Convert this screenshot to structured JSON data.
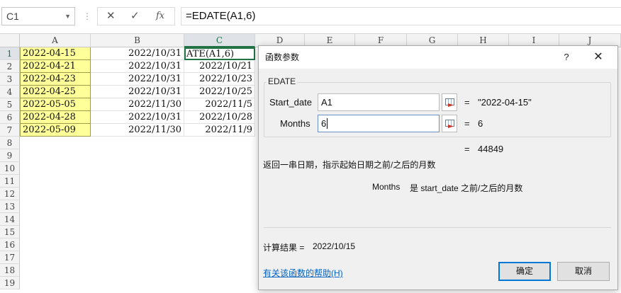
{
  "formula_bar": {
    "name_box": "C1",
    "dots": "⋮",
    "cancel_icon": "✕",
    "enter_icon": "✓",
    "fx_label": "fx",
    "formula": "=EDATE(A1,6)"
  },
  "sheet": {
    "columns": [
      "A",
      "B",
      "C",
      "D",
      "E",
      "F",
      "G",
      "H",
      "I",
      "J"
    ],
    "rows": [
      "1",
      "2",
      "3",
      "4",
      "5",
      "6",
      "7",
      "8",
      "9",
      "10",
      "11",
      "12",
      "13",
      "14",
      "15",
      "16",
      "17",
      "18",
      "19"
    ],
    "col_a": [
      "2022-04-15",
      "2022-04-21",
      "2022-04-23",
      "2022-04-25",
      "2022-05-05",
      "2022-04-28",
      "2022-05-09"
    ],
    "col_b": [
      "2022/10/31",
      "2022/10/31",
      "2022/10/31",
      "2022/10/31",
      "2022/11/30",
      "2022/10/31",
      "2022/11/30"
    ],
    "col_c": [
      "ATE(A1,6)",
      "2022/10/21",
      "2022/10/23",
      "2022/10/25",
      "2022/11/5",
      "2022/10/28",
      "2022/11/9"
    ],
    "highlight_color": "#ffff99",
    "selection_color": "#217346"
  },
  "dialog": {
    "title": "函数参数",
    "help_icon": "?",
    "close_icon": "✕",
    "function_name": "EDATE",
    "args": [
      {
        "label": "Start_date",
        "value": "A1",
        "eq": "=",
        "result": "\"2022-04-15\""
      },
      {
        "label": "Months",
        "value": "6",
        "eq": "=",
        "result": "6"
      }
    ],
    "overall_eq": "=",
    "overall_result": "44849",
    "description": "返回一串日期，指示起始日期之前/之后的月数",
    "arg_help_name": "Months",
    "arg_help_text": "是 start_date 之前/之后的月数",
    "calc_result_label": "计算结果 =",
    "calc_result_value": "2022/10/15",
    "help_link": "有关该函数的帮助(H)",
    "ok_label": "确定",
    "cancel_label": "取消",
    "accent_color": "#0078d7"
  }
}
